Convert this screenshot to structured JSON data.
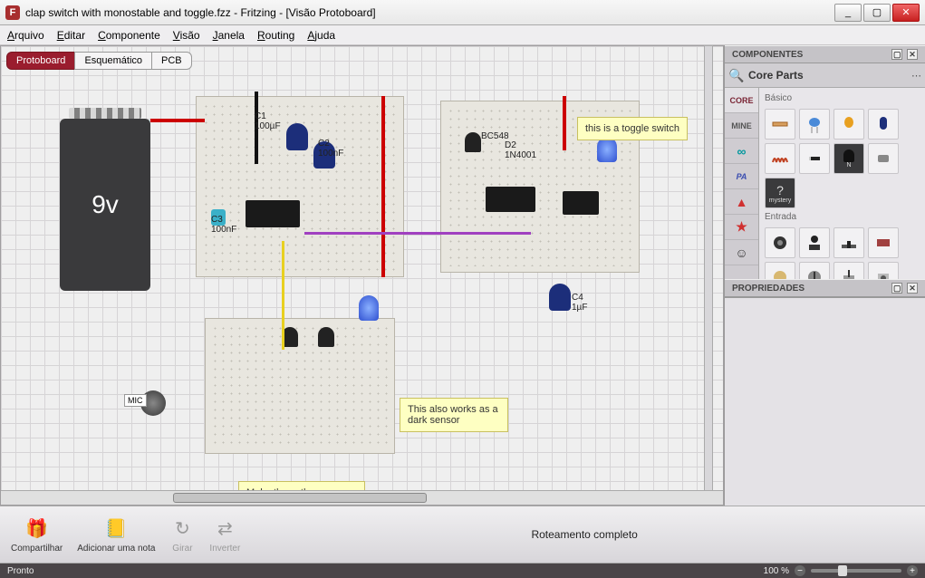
{
  "window": {
    "title": "clap switch with monostable and toggle.fzz - Fritzing - [Visão Protoboard]",
    "min": "_",
    "max": "▢",
    "close": "✕"
  },
  "menu": [
    {
      "ul": "A",
      "rest": "rquivo"
    },
    {
      "ul": "E",
      "rest": "ditar"
    },
    {
      "ul": "C",
      "rest": "omponente"
    },
    {
      "ul": "V",
      "rest": "isão"
    },
    {
      "ul": "J",
      "rest": "anela"
    },
    {
      "ul": "R",
      "rest": "outing"
    },
    {
      "ul": "A",
      "rest": "juda"
    }
  ],
  "views": {
    "protoboard": "Protoboard",
    "schematic": "Esquemático",
    "pcb": "PCB"
  },
  "battery_label": "9v",
  "part_labels": {
    "c1": "C1",
    "c1v": "100µF",
    "c2": "C2",
    "c2v": "100nF",
    "c3": "C3",
    "c3v": "100nF",
    "bc": "BC548",
    "d2": "D2",
    "d2v": "1N4001",
    "c4": "C4",
    "c4v": "1µF",
    "mic": "MIC"
  },
  "notes": {
    "toggle": "this is a toggle switch",
    "dark": "This also works as a dark sensor",
    "modules": "Make these three modules separately and combine them to"
  },
  "right": {
    "components_hdr": "COMPONENTES",
    "core_parts": "Core Parts",
    "basic": "Básico",
    "input": "Entrada",
    "cats": {
      "core": "CORE",
      "mine": "MINE",
      "pa": "PA"
    },
    "mystery": "mystery",
    "props_hdr": "PROPRIEDADES"
  },
  "bottom": {
    "share": "Compartilhar",
    "addnote": "Adicionar uma nota",
    "rotate": "Girar",
    "invert": "Inverter",
    "routing": "Roteamento completo"
  },
  "status": {
    "ready": "Pronto",
    "zoom": "100 %"
  }
}
